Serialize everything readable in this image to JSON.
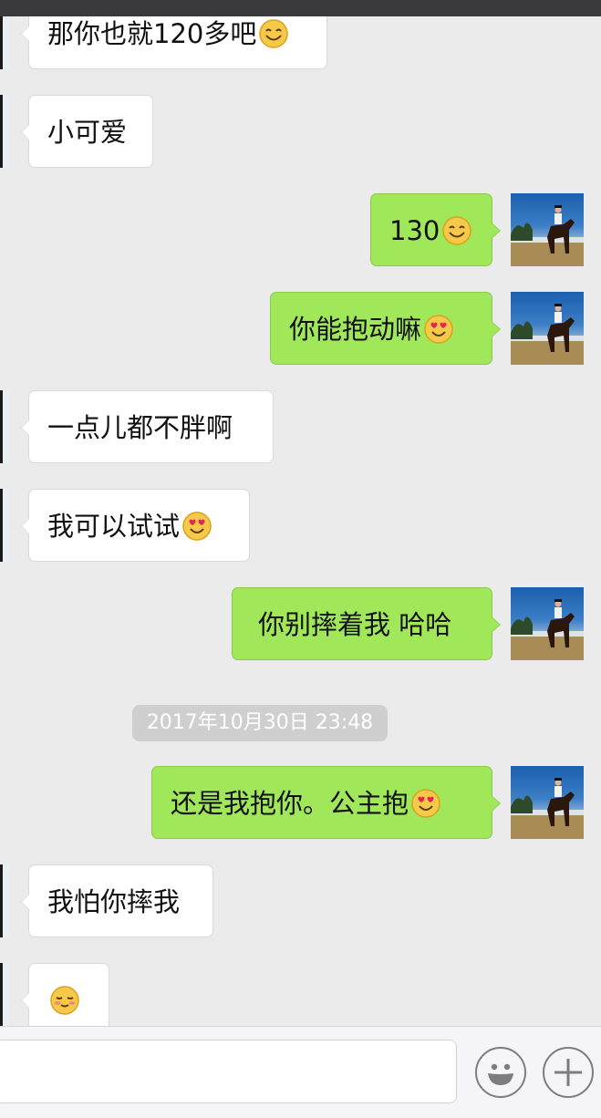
{
  "chat": {
    "messages": [
      {
        "side": "in",
        "text": "那你也就120多吧",
        "emoji": "smile"
      },
      {
        "side": "in",
        "text": "小可爱",
        "emoji": ""
      },
      {
        "side": "out",
        "text": "130",
        "emoji": "smile"
      },
      {
        "side": "out",
        "text": "你能抱动嘛",
        "emoji": "heart-eyes"
      },
      {
        "side": "in",
        "text": "一点儿都不胖啊",
        "emoji": ""
      },
      {
        "side": "in",
        "text": "我可以试试",
        "emoji": "heart-eyes"
      },
      {
        "side": "out",
        "text": "你别摔着我 哈哈",
        "emoji": ""
      },
      {
        "side": "out",
        "text": "还是我抱你。公主抱",
        "emoji": "heart-eyes"
      },
      {
        "side": "in",
        "text": "我怕你摔我",
        "emoji": ""
      },
      {
        "side": "in",
        "text": "",
        "emoji": "shy-smile"
      }
    ],
    "timestamp": "2017年10月30日 23:48"
  },
  "colors": {
    "background": "#ebebeb",
    "incoming_bubble": "#ffffff",
    "outgoing_bubble": "#a0e75a",
    "timestamp_pill": "#cfcfcf"
  },
  "input_bar": {
    "icons": [
      "emoji-face-icon",
      "plus-icon"
    ]
  }
}
